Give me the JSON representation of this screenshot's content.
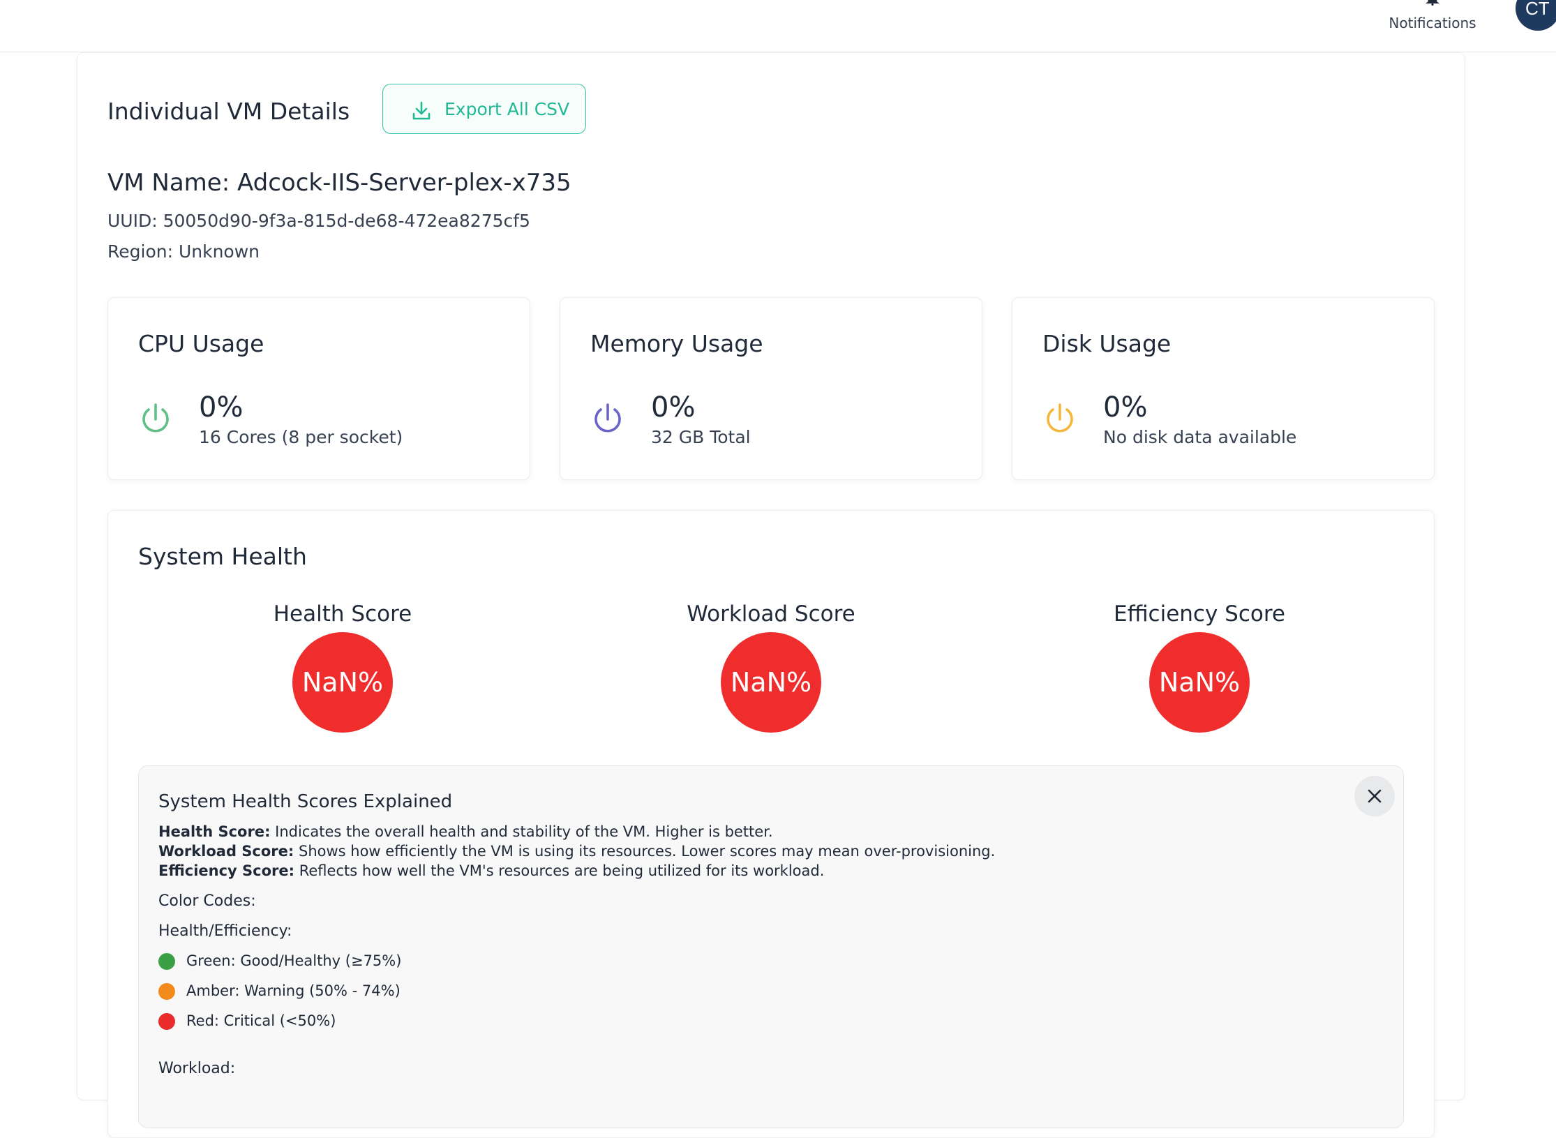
{
  "topbar": {
    "notifications_label": "Notifications",
    "avatar_initials": "CT"
  },
  "vm": {
    "section_title": "Individual VM Details",
    "export_label": "Export All CSV",
    "name_line": "VM Name: Adcock-IIS-Server-plex-x735",
    "uuid_line": "UUID: 50050d90-9f3a-815d-de68-472ea8275cf5",
    "region_line": "Region: Unknown"
  },
  "usage": {
    "cpu": {
      "title": "CPU Usage",
      "value": "0%",
      "detail": "16 Cores (8 per socket)",
      "icon": "power-icon",
      "color": "#5fbf86"
    },
    "memory": {
      "title": "Memory Usage",
      "value": "0%",
      "detail": "32 GB Total",
      "icon": "power-icon",
      "color": "#6c63c9"
    },
    "disk": {
      "title": "Disk Usage",
      "value": "0%",
      "detail": "No disk data available",
      "icon": "power-icon",
      "color": "#f5b73b"
    }
  },
  "health": {
    "title": "System Health",
    "scores": [
      {
        "label": "Health Score",
        "value": "NaN%"
      },
      {
        "label": "Workload Score",
        "value": "NaN%"
      },
      {
        "label": "Efficiency Score",
        "value": "NaN%"
      }
    ],
    "score_color": "#ef2d2d"
  },
  "explain": {
    "title": "System Health Scores Explained",
    "lines": [
      {
        "term": "Health Score:",
        "text": " Indicates the overall health and stability of the VM. Higher is better."
      },
      {
        "term": "Workload Score:",
        "text": " Shows how efficiently the VM is using its resources. Lower scores may mean over-provisioning."
      },
      {
        "term": "Efficiency Score:",
        "text": " Reflects how well the VM's resources are being utilized for its workload."
      }
    ],
    "color_codes_label": "Color Codes:",
    "health_eff_label": "Health/Efficiency:",
    "legend": [
      {
        "text": "Green: Good/Healthy (≥75%)",
        "color": "#3a9f45"
      },
      {
        "text": "Amber: Warning (50% - 74%)",
        "color": "#f38b1c"
      },
      {
        "text": "Red: Critical (<50%)",
        "color": "#ea2b2b"
      }
    ],
    "workload_label": "Workload:"
  }
}
